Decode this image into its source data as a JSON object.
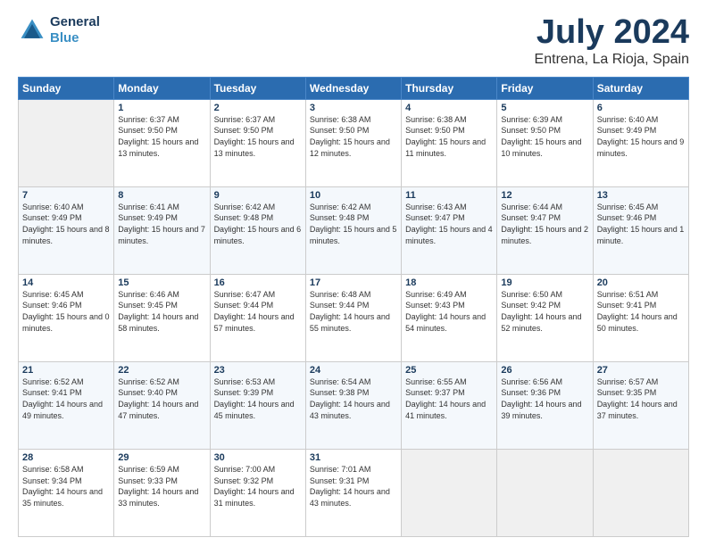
{
  "header": {
    "logo_line1": "General",
    "logo_line2": "Blue",
    "title": "July 2024",
    "subtitle": "Entrena, La Rioja, Spain"
  },
  "weekdays": [
    "Sunday",
    "Monday",
    "Tuesday",
    "Wednesday",
    "Thursday",
    "Friday",
    "Saturday"
  ],
  "weeks": [
    [
      {
        "day": "",
        "sunrise": "",
        "sunset": "",
        "daylight": "",
        "empty": true
      },
      {
        "day": "1",
        "sunrise": "Sunrise: 6:37 AM",
        "sunset": "Sunset: 9:50 PM",
        "daylight": "Daylight: 15 hours and 13 minutes."
      },
      {
        "day": "2",
        "sunrise": "Sunrise: 6:37 AM",
        "sunset": "Sunset: 9:50 PM",
        "daylight": "Daylight: 15 hours and 13 minutes."
      },
      {
        "day": "3",
        "sunrise": "Sunrise: 6:38 AM",
        "sunset": "Sunset: 9:50 PM",
        "daylight": "Daylight: 15 hours and 12 minutes."
      },
      {
        "day": "4",
        "sunrise": "Sunrise: 6:38 AM",
        "sunset": "Sunset: 9:50 PM",
        "daylight": "Daylight: 15 hours and 11 minutes."
      },
      {
        "day": "5",
        "sunrise": "Sunrise: 6:39 AM",
        "sunset": "Sunset: 9:50 PM",
        "daylight": "Daylight: 15 hours and 10 minutes."
      },
      {
        "day": "6",
        "sunrise": "Sunrise: 6:40 AM",
        "sunset": "Sunset: 9:49 PM",
        "daylight": "Daylight: 15 hours and 9 minutes."
      }
    ],
    [
      {
        "day": "7",
        "sunrise": "Sunrise: 6:40 AM",
        "sunset": "Sunset: 9:49 PM",
        "daylight": "Daylight: 15 hours and 8 minutes."
      },
      {
        "day": "8",
        "sunrise": "Sunrise: 6:41 AM",
        "sunset": "Sunset: 9:49 PM",
        "daylight": "Daylight: 15 hours and 7 minutes."
      },
      {
        "day": "9",
        "sunrise": "Sunrise: 6:42 AM",
        "sunset": "Sunset: 9:48 PM",
        "daylight": "Daylight: 15 hours and 6 minutes."
      },
      {
        "day": "10",
        "sunrise": "Sunrise: 6:42 AM",
        "sunset": "Sunset: 9:48 PM",
        "daylight": "Daylight: 15 hours and 5 minutes."
      },
      {
        "day": "11",
        "sunrise": "Sunrise: 6:43 AM",
        "sunset": "Sunset: 9:47 PM",
        "daylight": "Daylight: 15 hours and 4 minutes."
      },
      {
        "day": "12",
        "sunrise": "Sunrise: 6:44 AM",
        "sunset": "Sunset: 9:47 PM",
        "daylight": "Daylight: 15 hours and 2 minutes."
      },
      {
        "day": "13",
        "sunrise": "Sunrise: 6:45 AM",
        "sunset": "Sunset: 9:46 PM",
        "daylight": "Daylight: 15 hours and 1 minute."
      }
    ],
    [
      {
        "day": "14",
        "sunrise": "Sunrise: 6:45 AM",
        "sunset": "Sunset: 9:46 PM",
        "daylight": "Daylight: 15 hours and 0 minutes."
      },
      {
        "day": "15",
        "sunrise": "Sunrise: 6:46 AM",
        "sunset": "Sunset: 9:45 PM",
        "daylight": "Daylight: 14 hours and 58 minutes."
      },
      {
        "day": "16",
        "sunrise": "Sunrise: 6:47 AM",
        "sunset": "Sunset: 9:44 PM",
        "daylight": "Daylight: 14 hours and 57 minutes."
      },
      {
        "day": "17",
        "sunrise": "Sunrise: 6:48 AM",
        "sunset": "Sunset: 9:44 PM",
        "daylight": "Daylight: 14 hours and 55 minutes."
      },
      {
        "day": "18",
        "sunrise": "Sunrise: 6:49 AM",
        "sunset": "Sunset: 9:43 PM",
        "daylight": "Daylight: 14 hours and 54 minutes."
      },
      {
        "day": "19",
        "sunrise": "Sunrise: 6:50 AM",
        "sunset": "Sunset: 9:42 PM",
        "daylight": "Daylight: 14 hours and 52 minutes."
      },
      {
        "day": "20",
        "sunrise": "Sunrise: 6:51 AM",
        "sunset": "Sunset: 9:41 PM",
        "daylight": "Daylight: 14 hours and 50 minutes."
      }
    ],
    [
      {
        "day": "21",
        "sunrise": "Sunrise: 6:52 AM",
        "sunset": "Sunset: 9:41 PM",
        "daylight": "Daylight: 14 hours and 49 minutes."
      },
      {
        "day": "22",
        "sunrise": "Sunrise: 6:52 AM",
        "sunset": "Sunset: 9:40 PM",
        "daylight": "Daylight: 14 hours and 47 minutes."
      },
      {
        "day": "23",
        "sunrise": "Sunrise: 6:53 AM",
        "sunset": "Sunset: 9:39 PM",
        "daylight": "Daylight: 14 hours and 45 minutes."
      },
      {
        "day": "24",
        "sunrise": "Sunrise: 6:54 AM",
        "sunset": "Sunset: 9:38 PM",
        "daylight": "Daylight: 14 hours and 43 minutes."
      },
      {
        "day": "25",
        "sunrise": "Sunrise: 6:55 AM",
        "sunset": "Sunset: 9:37 PM",
        "daylight": "Daylight: 14 hours and 41 minutes."
      },
      {
        "day": "26",
        "sunrise": "Sunrise: 6:56 AM",
        "sunset": "Sunset: 9:36 PM",
        "daylight": "Daylight: 14 hours and 39 minutes."
      },
      {
        "day": "27",
        "sunrise": "Sunrise: 6:57 AM",
        "sunset": "Sunset: 9:35 PM",
        "daylight": "Daylight: 14 hours and 37 minutes."
      }
    ],
    [
      {
        "day": "28",
        "sunrise": "Sunrise: 6:58 AM",
        "sunset": "Sunset: 9:34 PM",
        "daylight": "Daylight: 14 hours and 35 minutes."
      },
      {
        "day": "29",
        "sunrise": "Sunrise: 6:59 AM",
        "sunset": "Sunset: 9:33 PM",
        "daylight": "Daylight: 14 hours and 33 minutes."
      },
      {
        "day": "30",
        "sunrise": "Sunrise: 7:00 AM",
        "sunset": "Sunset: 9:32 PM",
        "daylight": "Daylight: 14 hours and 31 minutes."
      },
      {
        "day": "31",
        "sunrise": "Sunrise: 7:01 AM",
        "sunset": "Sunset: 9:31 PM",
        "daylight": "Daylight: 14 hours and 43 minutes."
      },
      {
        "day": "",
        "sunrise": "",
        "sunset": "",
        "daylight": "",
        "empty": true
      },
      {
        "day": "",
        "sunrise": "",
        "sunset": "",
        "daylight": "",
        "empty": true
      },
      {
        "day": "",
        "sunrise": "",
        "sunset": "",
        "daylight": "",
        "empty": true
      }
    ]
  ]
}
